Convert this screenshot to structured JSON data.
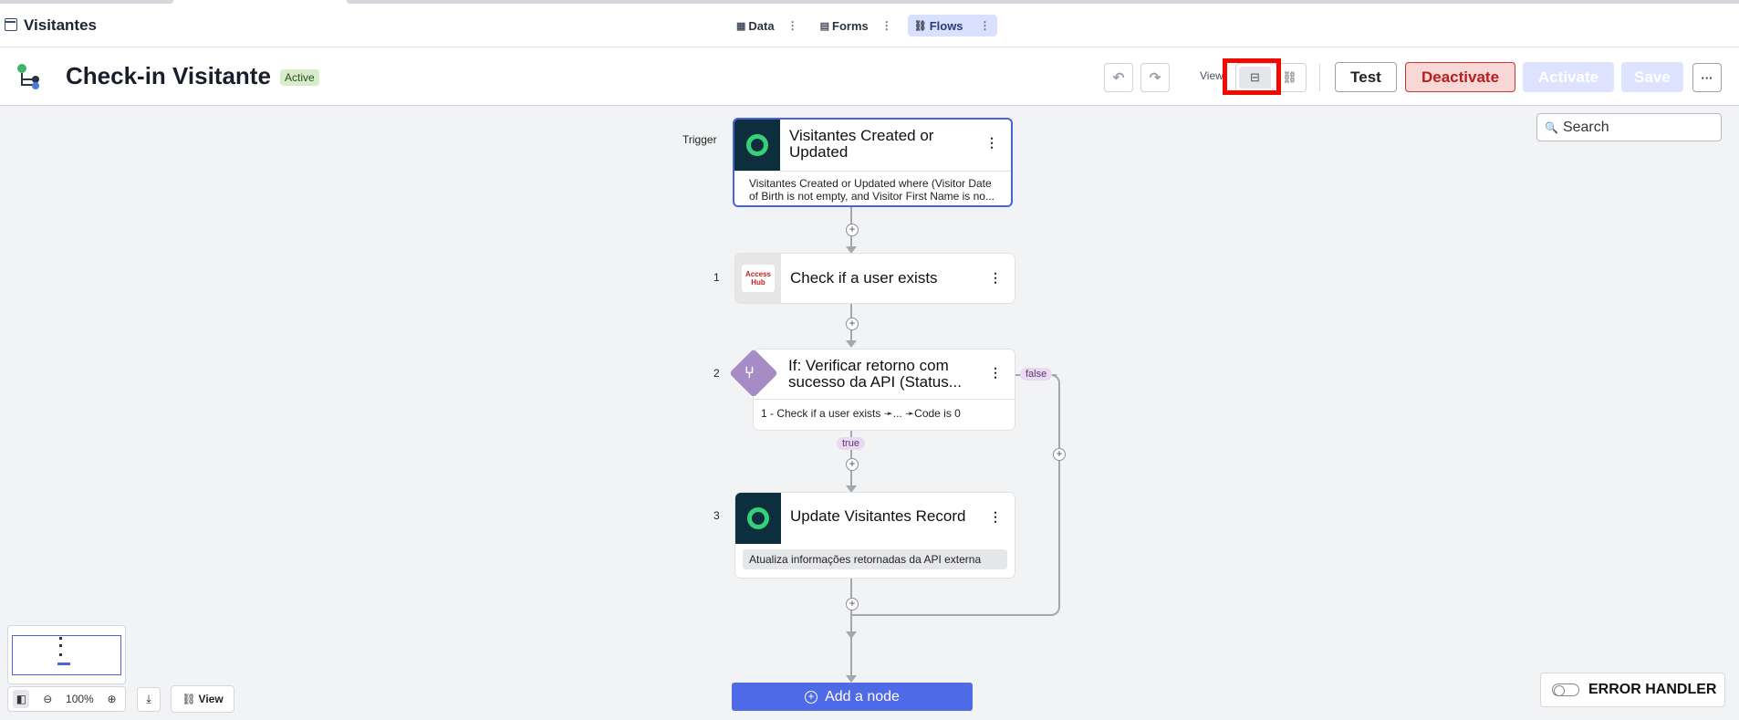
{
  "app": {
    "title": "Visitantes"
  },
  "nav": {
    "tabs": [
      {
        "label": "Data",
        "icon": "table-icon"
      },
      {
        "label": "Forms",
        "icon": "form-icon"
      },
      {
        "label": "Flows",
        "icon": "flows-icon",
        "active": true
      }
    ],
    "more_glyph": "⋮"
  },
  "header": {
    "title": "Check-in Visitante",
    "status": "Active",
    "view_label": "View",
    "buttons": {
      "test": "Test",
      "deactivate": "Deactivate",
      "activate": "Activate",
      "save": "Save",
      "more": "···"
    }
  },
  "search": {
    "label": "Search"
  },
  "flow": {
    "trigger_label": "Trigger",
    "trigger": {
      "title": "Visitantes Created or Updated",
      "description": "Visitantes Created or Updated where (Visitor Date of Birth is not empty, and Visitor First Name is no..."
    },
    "steps": [
      {
        "number": "1",
        "title": "Check if a user exists",
        "logo_text": "Access Hub"
      },
      {
        "number": "2",
        "title": "If: Verificar retorno com sucesso da API (Status...",
        "condition": "1 - Check if a user exists ➛... ➛Code is 0",
        "true_label": "true",
        "false_label": "false"
      },
      {
        "number": "3",
        "title": "Update Visitantes Record",
        "description": "Atualiza informações retornadas da API externa"
      }
    ],
    "add_node": "Add a node"
  },
  "bottom": {
    "zoom": "100%",
    "view": "View",
    "error_handler": "ERROR HANDLER"
  },
  "colors": {
    "accent": "#4f6ae6",
    "status_bg": "#d7ecc9",
    "danger": "#b51f1f",
    "highlight": "#f20a00",
    "node_dark": "#0d2f3d",
    "ring_green": "#37d07a",
    "condition_purple": "#a78bc4"
  }
}
